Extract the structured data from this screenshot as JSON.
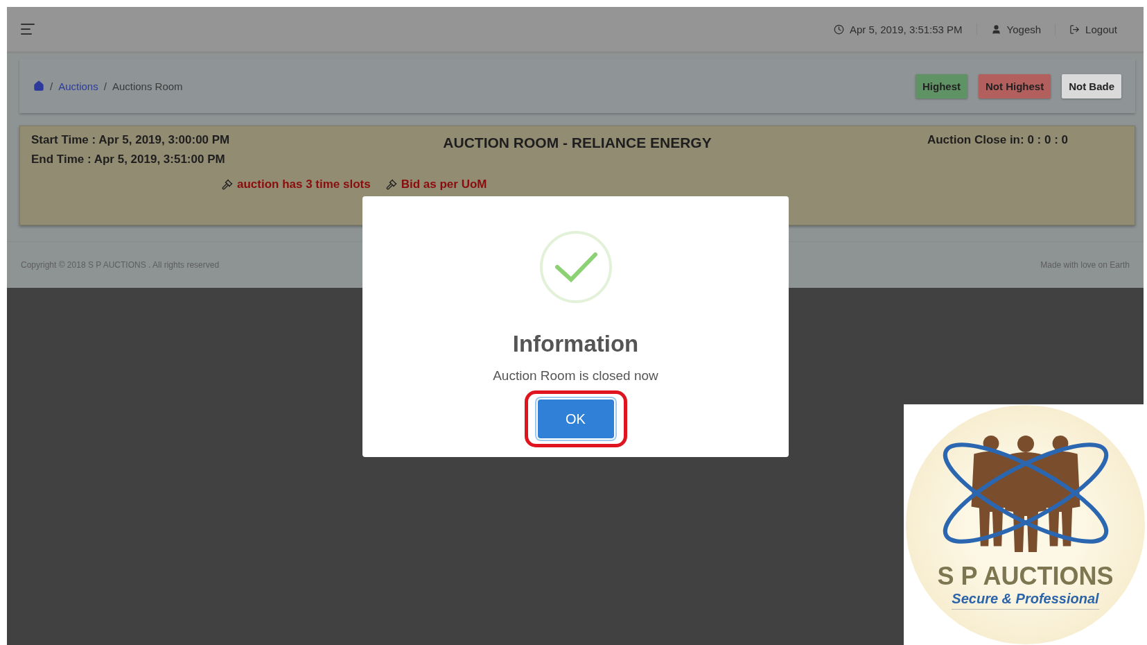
{
  "topbar": {
    "datetime": "Apr 5, 2019, 3:51:53 PM",
    "user": "Yogesh",
    "logout": "Logout"
  },
  "breadcrumb_separator": "/",
  "breadcrumb": [
    {
      "label": "Auctions",
      "kind": "link"
    },
    {
      "label": "Auctions Room",
      "kind": "current"
    }
  ],
  "legend": [
    {
      "label": "Highest",
      "color": "#5f9265"
    },
    {
      "label": "Not Highest",
      "color": "#b35f5d"
    },
    {
      "label": "Not Bade",
      "color": "#dadada"
    }
  ],
  "auction": {
    "start": "Start Time : Apr 5, 2019, 3:00:00 PM",
    "end": "End Time : Apr 5, 2019, 3:51:00 PM",
    "title": "AUCTION ROOM - RELIANCE ENERGY",
    "countdown": "Auction Close in: 0 : 0 : 0",
    "notes": [
      "auction has 3 time slots",
      "Bid as per UoM"
    ]
  },
  "footer": {
    "copyright": "Copyright © 2018 S P AUCTIONS . All rights reserved",
    "tagline": "Made with love on Earth"
  },
  "dialog": {
    "title": "Information",
    "message": "Auction Room is closed now",
    "button": "OK"
  },
  "logo": {
    "name": "S P AUCTIONS",
    "slogan": "Secure & Professional"
  }
}
